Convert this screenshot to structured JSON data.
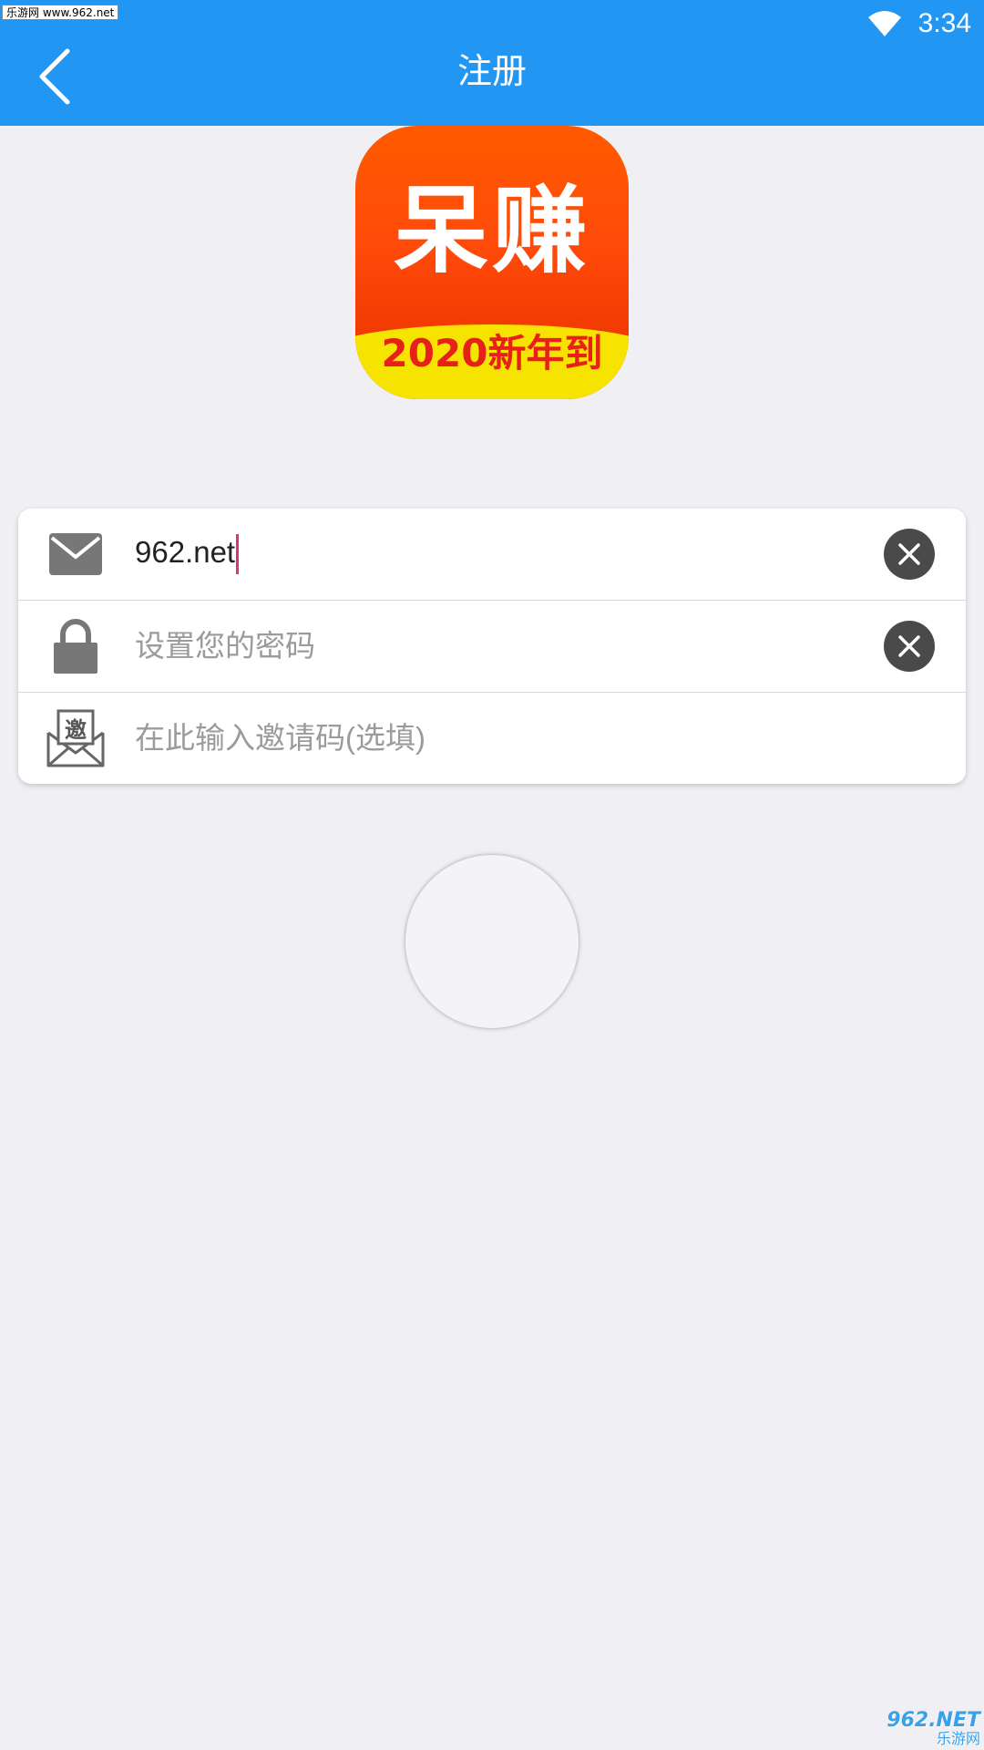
{
  "status_bar": {
    "watermark": "乐游网 www.962.net",
    "time": "3:34"
  },
  "header": {
    "title": "注册"
  },
  "logo": {
    "main_text": "呆赚",
    "sub_text": "2020新年到"
  },
  "form": {
    "email": {
      "value": "962.net"
    },
    "password": {
      "placeholder": "设置您的密码"
    },
    "invite": {
      "placeholder": "在此输入邀请码(选填)",
      "icon_char": "邀"
    }
  },
  "watermark_corner": {
    "brand": "962.NET",
    "text": "乐游网"
  },
  "colors": {
    "header_bg": "#2196f3",
    "page_bg": "#efeff4",
    "caret": "#e0307a"
  }
}
